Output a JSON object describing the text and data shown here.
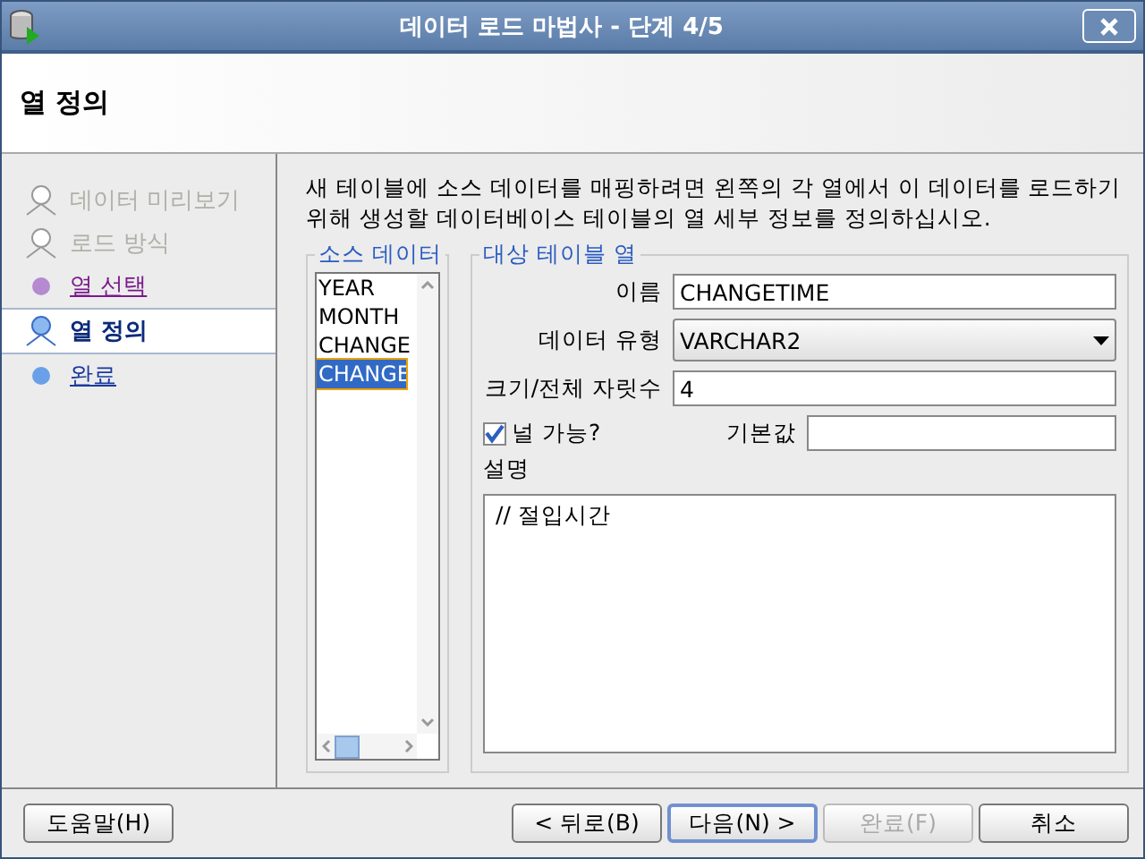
{
  "window": {
    "title": "데이터 로드 마법사 - 단계 4/5"
  },
  "header": {
    "title": "열 정의"
  },
  "steps": [
    {
      "label": "데이터 미리보기",
      "kind": "disabled",
      "selected": false
    },
    {
      "label": "로드 방식",
      "kind": "disabled",
      "selected": false
    },
    {
      "label": "열 선택",
      "kind": "visited",
      "selected": false
    },
    {
      "label": "열 정의",
      "kind": "current",
      "selected": true
    },
    {
      "label": "완료",
      "kind": "pending",
      "selected": false
    }
  ],
  "instructions": "새 테이블에 소스 데이터를 매핑하려면 왼쪽의 각 열에서 이 데이터를 로드하기 위해 생성할 데이터베이스 테이블의 열 세부 정보를 정의하십시오.",
  "source": {
    "title": "소스 데이터",
    "items": [
      {
        "label": "YEAR",
        "selected": false
      },
      {
        "label": "MONTH",
        "selected": false
      },
      {
        "label": "CHANGE",
        "selected": false
      },
      {
        "label": "CHANGE",
        "selected": true
      }
    ]
  },
  "target": {
    "title": "대상 테이블 열",
    "name": {
      "label": "이름",
      "value": "CHANGETIME"
    },
    "data_type": {
      "label": "데이터 유형",
      "value": "VARCHAR2"
    },
    "size": {
      "label": "크기/전체 자릿수",
      "value": "4"
    },
    "nullable": {
      "label": "널 가능?",
      "checked": true
    },
    "default": {
      "label": "기본값"
    },
    "description": {
      "label": "설명",
      "value": "// 절입시간"
    }
  },
  "buttons": [
    {
      "label": "도움말(H)",
      "kind": "help",
      "disabled": false
    },
    {
      "label": "< 뒤로(B)",
      "kind": "nav",
      "disabled": false
    },
    {
      "label": "다음(N) >",
      "kind": "default",
      "disabled": false
    },
    {
      "label": "완료(F)",
      "kind": "nav",
      "disabled": true
    },
    {
      "label": "취소",
      "kind": "nav",
      "disabled": false
    }
  ]
}
